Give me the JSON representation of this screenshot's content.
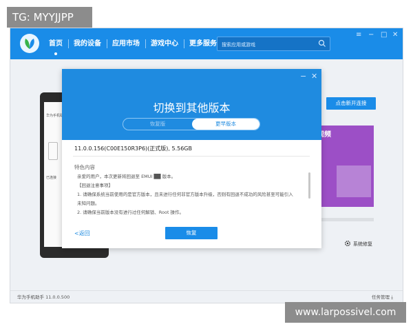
{
  "watermark": {
    "top": "TG: MYYJJPP",
    "bottom": "www.larpossivel.com"
  },
  "nav": [
    "首页",
    "我的设备",
    "应用市场",
    "游戏中心",
    "更多服务"
  ],
  "search": {
    "placeholder": "搜索应用或游戏"
  },
  "window_controls": {
    "menu": "≡",
    "minimize": "−",
    "maximize": "□",
    "close": "✕"
  },
  "background": {
    "connect_button": "点击新开连接",
    "phone_title": "华为手机助手",
    "phone_text": "已连接",
    "promo_text": "视频",
    "system_repair": "系统修复"
  },
  "dialog": {
    "title": "切换到其他版本",
    "tab_left": "恢复版",
    "tab_right": "更早版本",
    "version": "11.0.0.156(C00E150R3P6)(正式版), 5.56GB",
    "section_title": "特色内容",
    "notes": [
      "亲爱的用户，本次更新将回退至 EMUI ██ 版本。",
      "【回退注意事项】",
      "1. 请确保系统当前使用的是官方版本，且未进行任何非官方版本升级，否则有回退不成功的风险甚至可能引入",
      "未知问题。",
      "2. 请确保当前版本没有进行过任何解锁、Root 操作。"
    ],
    "back": "<返回",
    "restore": "恢复"
  },
  "status": {
    "left": "华为手机助手 11.0.0.500",
    "right": "任务管理  ⤓"
  },
  "colors": {
    "primary": "#1a8ce8",
    "promo": "#9c4fc6"
  }
}
